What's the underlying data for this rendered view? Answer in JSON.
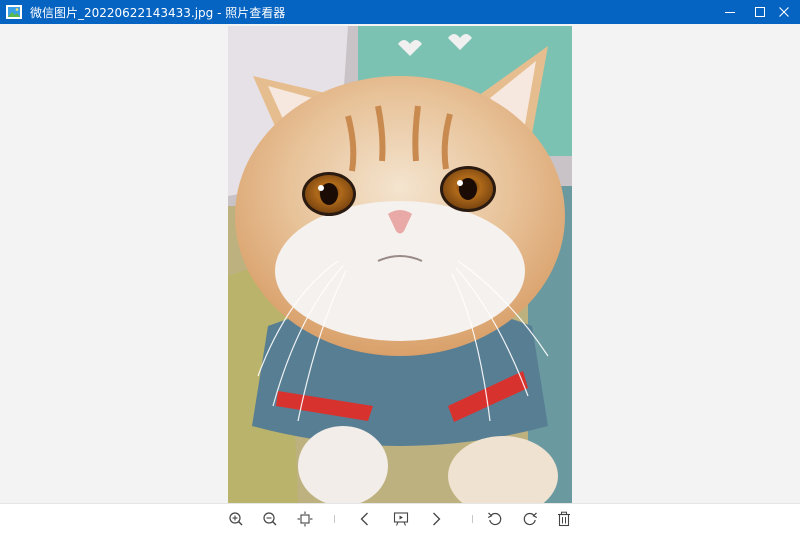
{
  "window": {
    "title": "微信图片_20220622143433.jpg - 照片查看器",
    "accent": "#0563c1"
  },
  "image": {
    "subject": "exotic-shorthair-cat-photo"
  },
  "window_controls": {
    "minimize_icon": "minimize-icon",
    "maximize_icon": "maximize-icon",
    "close_icon": "close-icon"
  },
  "toolbar": {
    "buttons": [
      {
        "icon": "zoom-in-icon"
      },
      {
        "icon": "zoom-out-icon"
      },
      {
        "icon": "fit-to-window-icon"
      },
      {
        "icon": "previous-icon"
      },
      {
        "icon": "slideshow-icon"
      },
      {
        "icon": "next-icon"
      },
      {
        "icon": "rotate-left-icon"
      },
      {
        "icon": "rotate-right-icon"
      },
      {
        "icon": "delete-icon"
      }
    ]
  }
}
